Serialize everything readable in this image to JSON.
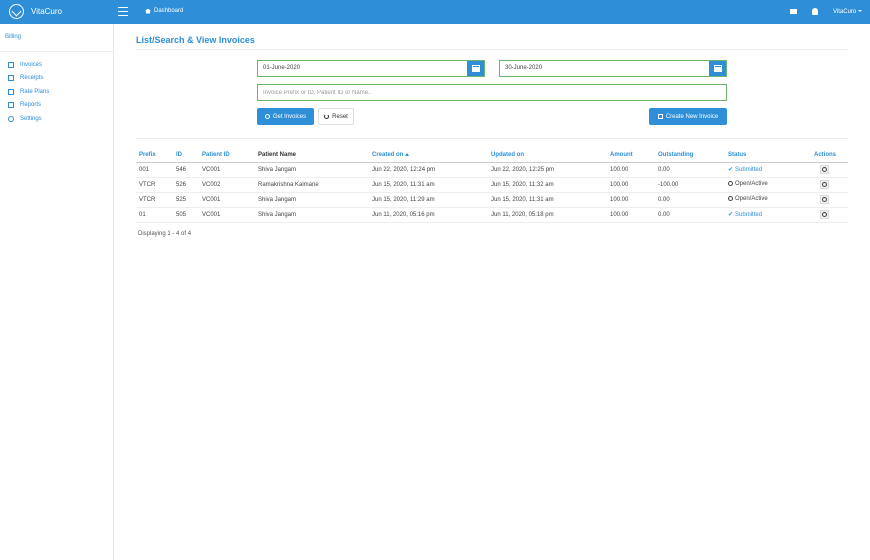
{
  "app": {
    "name": "VitaCuro"
  },
  "topbar": {
    "dashboard_label": "Dashboard",
    "user_label": "VitaCuro"
  },
  "sidebar": {
    "section": "Billing",
    "items": [
      {
        "label": "Invoices",
        "icon": "invoice-icon"
      },
      {
        "label": "Receipts",
        "icon": "receipt-icon"
      },
      {
        "label": "Rate Plans",
        "icon": "rate-plan-icon"
      },
      {
        "label": "Reports",
        "icon": "report-icon"
      },
      {
        "label": "Settings",
        "icon": "gear-icon"
      }
    ]
  },
  "page": {
    "title": "List/Search & View Invoices"
  },
  "filters": {
    "from_date": "01-June-2020",
    "to_date": "30-June-2020",
    "search_placeholder": "Invoice Prefix or ID, Patient ID or Name.."
  },
  "buttons": {
    "get_invoices": "Get Invoices",
    "reset": "Reset",
    "create_invoice": "Create New Invoice"
  },
  "table": {
    "columns": [
      "Prefix",
      "ID",
      "Patient ID",
      "Patient Name",
      "Created on",
      "Updated on",
      "Amount",
      "Outstanding",
      "Status",
      "Actions"
    ],
    "rows": [
      {
        "prefix": "001",
        "id": "546",
        "patient_id": "VC001",
        "patient_name": "Shiva Jangam",
        "created": "Jun 22, 2020, 12:24 pm",
        "updated": "Jun 22, 2020, 12:25 pm",
        "amount": "100.00",
        "outstanding": "0.00",
        "status": "Submitted"
      },
      {
        "prefix": "VTCR",
        "id": "526",
        "patient_id": "VC002",
        "patient_name": "Ramakrishna Kalmane",
        "created": "Jun 15, 2020, 11:31 am",
        "updated": "Jun 15, 2020, 11:32 am",
        "amount": "100.00",
        "outstanding": "-100.00",
        "status": "Open/Active"
      },
      {
        "prefix": "VTCR",
        "id": "525",
        "patient_id": "VC001",
        "patient_name": "Shiva Jangam",
        "created": "Jun 15, 2020, 11:29 am",
        "updated": "Jun 15, 2020, 11:31 am",
        "amount": "100.00",
        "outstanding": "0.00",
        "status": "Open/Active"
      },
      {
        "prefix": "01",
        "id": "505",
        "patient_id": "VC001",
        "patient_name": "Shiva Jangam",
        "created": "Jun 11, 2020, 05:16 pm",
        "updated": "Jun 11, 2020, 05:18 pm",
        "amount": "100.00",
        "outstanding": "0.00",
        "status": "Submitted"
      }
    ]
  },
  "footer": {
    "text": "Displaying 1 - 4 of 4"
  },
  "colors": {
    "accent": "#2e8fd8",
    "valid_border": "#6cb36c"
  }
}
